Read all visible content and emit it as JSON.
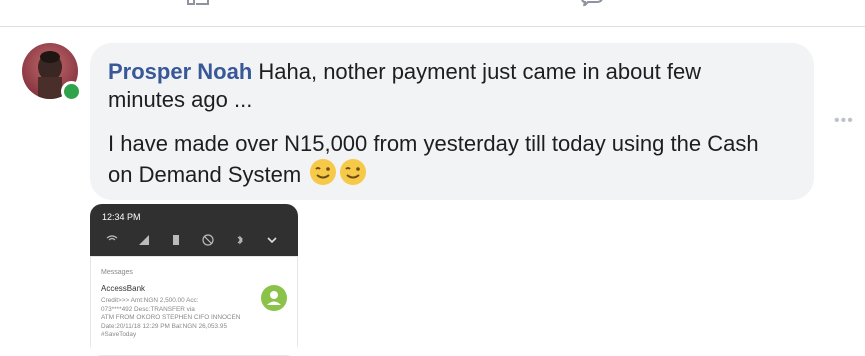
{
  "comment": {
    "author": "Prosper Noah",
    "line1_rest": " Haha, nother payment just came in about few",
    "line2": "minutes ago ...",
    "line3": "I have made over N15,000 from yesterday till today using the Cash",
    "line4": "on Demand System"
  },
  "icons": {
    "top_left": "like-icon",
    "top_right": "comment-icon",
    "emoji": "winking-smile-emoji-icon",
    "more": "more-options-icon",
    "online": "online-status-icon"
  },
  "colors": {
    "author": "#385898",
    "bubble": "#f2f3f5",
    "online": "#31a24c"
  },
  "attachment": {
    "time": "12:34 PM",
    "app_label": "Messages",
    "sender": "AccessBank",
    "body_lines": [
      "Credit>>> Amt:NGN 2,500.00 Acc:",
      "073****492 Desc:TRANSFER via",
      "ATM FROM OKORO STEPHEN CIFO INNOCEN",
      "Date:20/11/18 12:29 PM Bal:NGN 26,053.95",
      "#SaveToday"
    ]
  }
}
